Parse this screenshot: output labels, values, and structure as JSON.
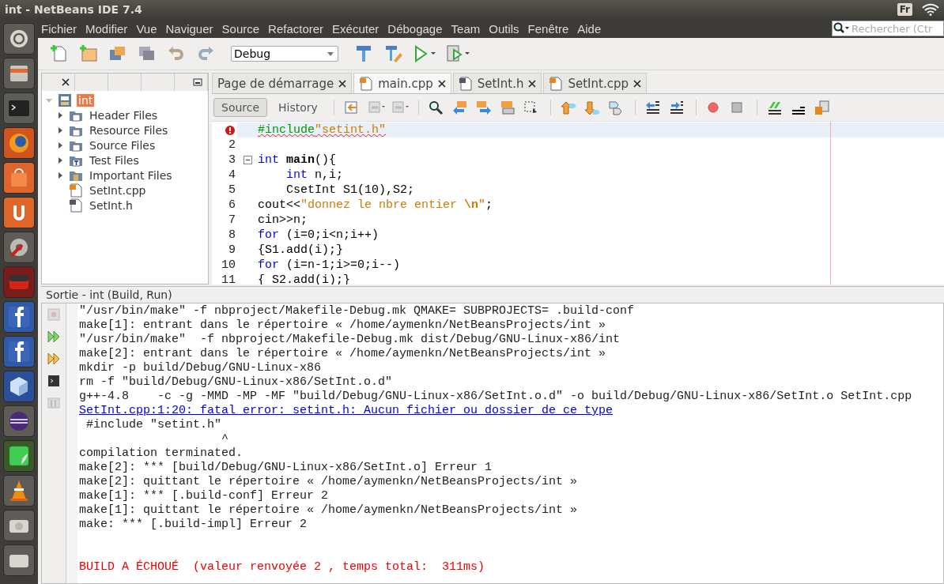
{
  "top_bar": {
    "title": "int - NetBeans IDE 7.4",
    "keyboard_layout": "Fr"
  },
  "menu": [
    "Fichier",
    "Modifier",
    "Vue",
    "Naviguer",
    "Source",
    "Refactorer",
    "Exécuter",
    "Débogage",
    "Team",
    "Outils",
    "Fenêtre",
    "Aide"
  ],
  "search": {
    "placeholder": "Rechercher (Ctr"
  },
  "toolbar": {
    "configuration": "Debug"
  },
  "projects_panel": {
    "tree": [
      {
        "label": "int",
        "kind": "project",
        "expanded": true,
        "selected": true,
        "children": [
          {
            "label": "Header Files",
            "kind": "folder",
            "expanded": false,
            "selected": false
          },
          {
            "label": "Resource Files",
            "kind": "folder",
            "expanded": false,
            "selected": false
          },
          {
            "label": "Source Files",
            "kind": "folder",
            "expanded": false,
            "selected": false
          },
          {
            "label": "Test Files",
            "kind": "test-folder",
            "expanded": false,
            "selected": false
          },
          {
            "label": "Important Files",
            "kind": "important-folder",
            "expanded": false,
            "selected": false
          },
          {
            "label": "SetInt.cpp",
            "kind": "source",
            "selected": false
          },
          {
            "label": "SetInt.h",
            "kind": "header",
            "selected": false
          }
        ]
      }
    ]
  },
  "editor": {
    "tabs": [
      {
        "label": "Page de démarrage",
        "kind": "page",
        "selected": false
      },
      {
        "label": "main.cpp",
        "kind": "source",
        "selected": true
      },
      {
        "label": "SetInt.h",
        "kind": "header",
        "selected": false
      },
      {
        "label": "SetInt.cpp",
        "kind": "source",
        "selected": false
      }
    ],
    "views": [
      {
        "label": "Source",
        "selected": true
      },
      {
        "label": "History",
        "selected": false
      }
    ],
    "lines": [
      {
        "error": true,
        "current": true,
        "fold": false,
        "tokens": [
          {
            "kind": "preprocessor",
            "text": "#include"
          },
          {
            "kind": "string",
            "text": "\"setint.h\""
          }
        ]
      },
      {
        "number": "2",
        "error": false,
        "current": false,
        "fold": false
      },
      {
        "number": "3",
        "error": false,
        "current": false,
        "fold": true,
        "tokens": [
          {
            "kind": "keyword",
            "text": "int"
          },
          {
            "kind": "bold",
            "text": " main"
          },
          {
            "kind": "plain",
            "text": "(){"
          }
        ]
      },
      {
        "number": "4",
        "error": false,
        "current": false,
        "fold": false,
        "tokens": [
          {
            "kind": "keyword",
            "text": "    int"
          },
          {
            "kind": "plain",
            "text": " n,i;"
          }
        ]
      },
      {
        "number": "5",
        "error": false,
        "current": false,
        "fold": false,
        "tokens": [
          {
            "kind": "plain",
            "text": "    CsetInt S1(10),S2;"
          }
        ]
      },
      {
        "number": "6",
        "error": false,
        "current": false,
        "fold": false,
        "tokens": [
          {
            "kind": "plain",
            "text": "cout<<"
          },
          {
            "kind": "string",
            "text": "\"donnez le nbre entier "
          },
          {
            "kind": "escape",
            "text": "\\n"
          },
          {
            "kind": "string",
            "text": "\""
          },
          {
            "kind": "plain",
            "text": ";"
          }
        ]
      },
      {
        "number": "7",
        "error": false,
        "current": false,
        "fold": false,
        "tokens": [
          {
            "kind": "plain",
            "text": "cin>>n;"
          }
        ]
      },
      {
        "number": "8",
        "error": false,
        "current": false,
        "fold": false,
        "tokens": [
          {
            "kind": "keyword",
            "text": "for"
          },
          {
            "kind": "plain",
            "text": " (i=0;i<n;i++)"
          }
        ]
      },
      {
        "number": "9",
        "error": false,
        "current": false,
        "fold": false,
        "tokens": [
          {
            "kind": "plain",
            "text": "{S1.add(i);}"
          }
        ]
      },
      {
        "number": "10",
        "error": false,
        "current": false,
        "fold": false,
        "tokens": [
          {
            "kind": "keyword",
            "text": "for"
          },
          {
            "kind": "plain",
            "text": " (i=n-1;i>=0;i--)"
          }
        ]
      },
      {
        "number": "11",
        "error": false,
        "current": false,
        "fold": false,
        "tokens": [
          {
            "kind": "plain",
            "text": "{ S2.add(i);}"
          }
        ]
      }
    ]
  },
  "output": {
    "title": "Sortie - int (Build, Run)",
    "lines": [
      {
        "kind": "plain",
        "text": "\"/usr/bin/make\" -f nbproject/Makefile-Debug.mk QMAKE= SUBPROJECTS= .build-conf"
      },
      {
        "kind": "plain",
        "text": "make[1]: entrant dans le répertoire « /home/aymenkn/NetBeansProjects/int »"
      },
      {
        "kind": "plain",
        "text": "\"/usr/bin/make\"  -f nbproject/Makefile-Debug.mk dist/Debug/GNU-Linux-x86/int"
      },
      {
        "kind": "plain",
        "text": "make[2]: entrant dans le répertoire « /home/aymenkn/NetBeansProjects/int »"
      },
      {
        "kind": "plain",
        "text": "mkdir -p build/Debug/GNU-Linux-x86"
      },
      {
        "kind": "plain",
        "text": "rm -f \"build/Debug/GNU-Linux-x86/SetInt.o.d\""
      },
      {
        "kind": "plain",
        "text": "g++-4.8    -c -g -MMD -MP -MF \"build/Debug/GNU-Linux-x86/SetInt.o.d\" -o build/Debug/GNU-Linux-x86/SetInt.o SetInt.cpp"
      },
      {
        "kind": "link",
        "text": "SetInt.cpp:1:20: fatal error: setint.h: Aucun fichier ou dossier de ce type"
      },
      {
        "kind": "plain",
        "text": " #include \"setint.h\""
      },
      {
        "kind": "plain",
        "text": "                    ^"
      },
      {
        "kind": "plain",
        "text": "compilation terminated."
      },
      {
        "kind": "plain",
        "text": "make[2]: *** [build/Debug/GNU-Linux-x86/SetInt.o] Erreur 1"
      },
      {
        "kind": "plain",
        "text": "make[2]: quittant le répertoire « /home/aymenkn/NetBeansProjects/int »"
      },
      {
        "kind": "plain",
        "text": "make[1]: *** [.build-conf] Erreur 2"
      },
      {
        "kind": "plain",
        "text": "make[1]: quittant le répertoire « /home/aymenkn/NetBeansProjects/int »"
      },
      {
        "kind": "plain",
        "text": "make: *** [.build-impl] Erreur 2"
      },
      {
        "kind": "result",
        "text": "BUILD A ÉCHOUÉ  (valeur renvoyée 2 , temps total:  311ms)"
      }
    ]
  }
}
